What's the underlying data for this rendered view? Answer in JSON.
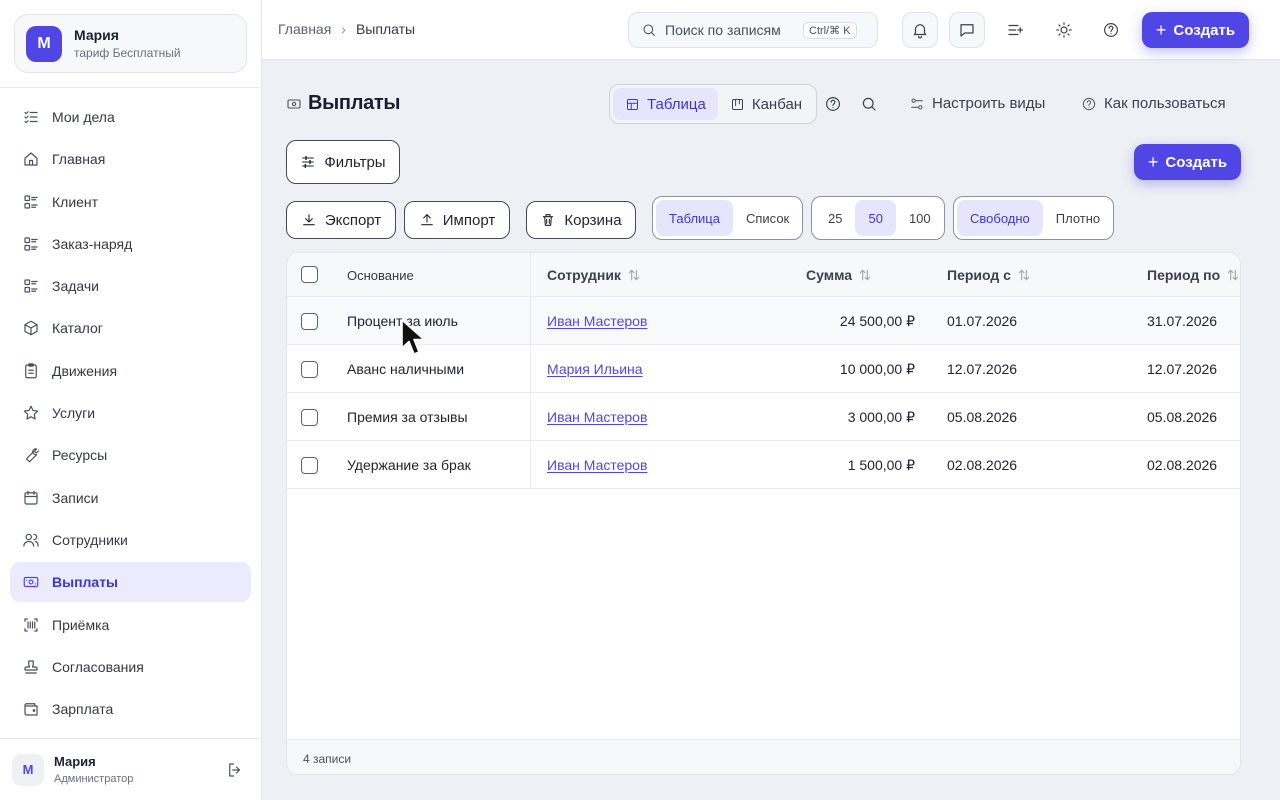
{
  "org": {
    "avatar": "М",
    "name": "Мария",
    "plan": "тариф Бесплатный"
  },
  "nav": [
    {
      "label": "Мои дела",
      "icon": "list-check-icon"
    },
    {
      "label": "Главная",
      "icon": "home-icon"
    },
    {
      "label": "Клиент",
      "icon": "list-icon"
    },
    {
      "label": "Заказ-наряд",
      "icon": "list-icon"
    },
    {
      "label": "Задачи",
      "icon": "list-icon"
    },
    {
      "label": "Каталог",
      "icon": "box-icon"
    },
    {
      "label": "Движения",
      "icon": "clipboard-icon"
    },
    {
      "label": "Услуги",
      "icon": "star-icon"
    },
    {
      "label": "Ресурсы",
      "icon": "wrench-icon"
    },
    {
      "label": "Записи",
      "icon": "calendar-icon"
    },
    {
      "label": "Сотрудники",
      "icon": "users-icon"
    },
    {
      "label": "Выплаты",
      "icon": "banknote-icon",
      "active": true
    },
    {
      "label": "Приёмка",
      "icon": "barcode-icon"
    },
    {
      "label": "Согласования",
      "icon": "stamp-icon"
    },
    {
      "label": "Зарплата",
      "icon": "wallet-icon"
    }
  ],
  "user": {
    "avatar": "М",
    "name": "Мария",
    "role": "Администратор"
  },
  "breadcrumb": {
    "home": "Главная",
    "current": "Выплаты"
  },
  "search": {
    "placeholder": "Поиск по записям",
    "shortcut": "Ctrl/⌘ K"
  },
  "topbar": {
    "create_label": "Создать"
  },
  "page": {
    "title": "Выплаты",
    "views": {
      "table": "Таблица",
      "kanban": "Канбан"
    },
    "configure_views": "Настроить виды",
    "how_to_use": "Как пользоваться",
    "filters_label": "Фильтры",
    "create_label": "Создать"
  },
  "toolbar": {
    "export": "Экспорт",
    "import": "Импорт",
    "trash": "Корзина",
    "mode": [
      "Таблица",
      "Список"
    ],
    "page_size": [
      "25",
      "50",
      "100"
    ],
    "density": [
      "Свободно",
      "Плотно"
    ]
  },
  "table": {
    "columns": {
      "basis": "Основание",
      "employee": "Сотрудник",
      "amount": "Сумма",
      "from": "Период с",
      "to": "Период по"
    },
    "rows": [
      {
        "basis": "Процент за июль",
        "employee": "Иван Мастеров",
        "amount": "24 500,00 ₽",
        "from": "01.07.2026",
        "to": "31.07.2026"
      },
      {
        "basis": "Аванс наличными",
        "employee": "Мария Ильина",
        "amount": "10 000,00 ₽",
        "from": "12.07.2026",
        "to": "12.07.2026"
      },
      {
        "basis": "Премия за отзывы",
        "employee": "Иван Мастеров",
        "amount": "3 000,00 ₽",
        "from": "05.08.2026",
        "to": "05.08.2026"
      },
      {
        "basis": "Удержание за брак",
        "employee": "Иван Мастеров",
        "amount": "1 500,00 ₽",
        "from": "02.08.2026",
        "to": "02.08.2026"
      }
    ],
    "footer": "4 записи"
  },
  "colors": {
    "accent": "#4f46e5",
    "active_bg": "#ecebfd"
  }
}
